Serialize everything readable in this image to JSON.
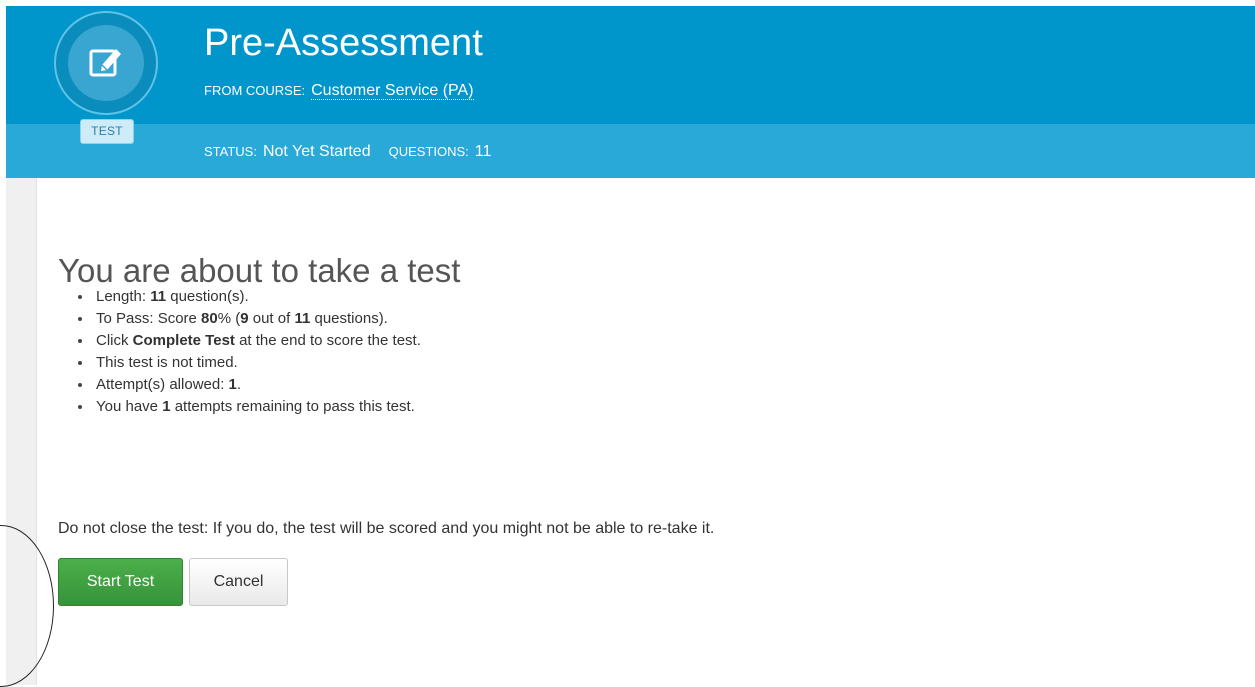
{
  "header": {
    "title": "Pre-Assessment",
    "from_label": "FROM COURSE:",
    "course_link": "Customer Service (PA)",
    "badge_label": "TEST",
    "badge_icon": "edit-pencil-icon",
    "status_label": "STATUS:",
    "status_value": "Not Yet Started",
    "questions_label": "QUESTIONS:",
    "questions_value": "11"
  },
  "main": {
    "heading": "You are about to take a test",
    "info": [
      {
        "pre": "Length: ",
        "b1": "11",
        "mid": " question(s)."
      },
      {
        "pre": "To Pass: Score ",
        "b1": "80",
        "mid": "% (",
        "b2": "9",
        "mid2": " out of ",
        "b3": "11",
        "post": " questions)."
      },
      {
        "pre": "Click ",
        "b1": "Complete Test",
        "mid": " at the end to score the test."
      },
      {
        "pre": "This test is not timed."
      },
      {
        "pre": "Attempt(s) allowed: ",
        "b1": "1",
        "mid": "."
      },
      {
        "pre": "You have ",
        "b1": "1",
        "mid": " attempts remaining to pass this test."
      }
    ],
    "warning": "Do not close the test: If you do, the test will be scored and you might not be able to re-take it.",
    "start_button": "Start Test",
    "cancel_button": "Cancel"
  },
  "colors": {
    "header_primary": "#0096cb",
    "header_secondary": "#29a9d7",
    "start_button": "#3c9e3c"
  }
}
